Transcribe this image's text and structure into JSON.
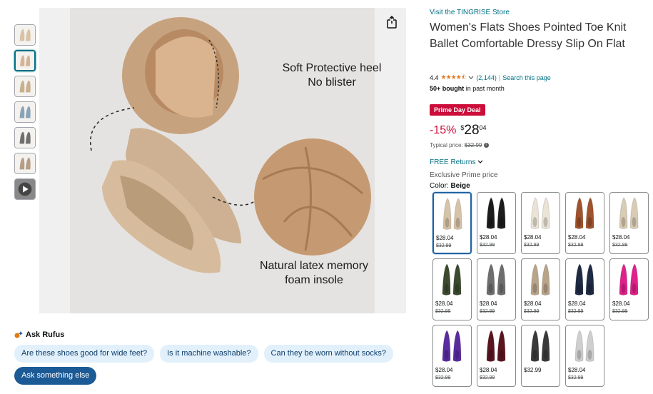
{
  "thumbnails": [
    {
      "name": "thumb-1",
      "color": "#d9c3a6"
    },
    {
      "name": "thumb-2",
      "color": "#d3b596"
    },
    {
      "name": "thumb-3",
      "color": "#c9b08f"
    },
    {
      "name": "thumb-4",
      "color": "#8aa3b8"
    },
    {
      "name": "thumb-5",
      "color": "#6f6f6f"
    },
    {
      "name": "thumb-6",
      "color": "#b49e86"
    },
    {
      "name": "thumb-7",
      "color": "#2f2f2f"
    }
  ],
  "main_image": {
    "caption_top_1": "Soft Protective heel",
    "caption_top_2": "No blister",
    "caption_bottom_1": "Natural latex memory",
    "caption_bottom_2": "foam insole"
  },
  "rufus": {
    "title": "Ask Rufus",
    "chips": [
      "Are these shoes good for wide feet?",
      "Is it machine washable?",
      "Can they be worn without socks?"
    ],
    "ask_label": "Ask something else"
  },
  "product": {
    "store_link": "Visit the TINGRISE Store",
    "title": "Women's Flats Shoes Pointed Toe Knit Ballet Comfortable Dressy Slip On Flat",
    "rating": "4.4",
    "stars": "★★★★⯪",
    "review_count": "(2,144)",
    "separator": "|",
    "search_link": "Search this page",
    "bought_bold": "50+ bought",
    "bought_rest": " in past month",
    "deal_badge": "Prime Day Deal",
    "discount": "-15%",
    "currency": "$",
    "price_whole": "28",
    "price_frac": "04",
    "typical_label": "Typical price: ",
    "typical_price": "$32.99",
    "returns": "FREE Returns",
    "exclusive": "Exclusive Prime price",
    "color_label": "Color: ",
    "color_value": "Beige"
  },
  "swatches": [
    {
      "price": "$28.04",
      "old": "$32.99",
      "color": "#d6c3a8",
      "selected": true
    },
    {
      "price": "$28.04",
      "old": "$32.99",
      "color": "#1c1c1c"
    },
    {
      "price": "$28.04",
      "old": "$32.99",
      "color": "#eae3d6"
    },
    {
      "price": "$28.04",
      "old": "$32.99",
      "color": "#a0522d"
    },
    {
      "price": "$28.04",
      "old": "$32.99",
      "color": "#d9ccb5"
    },
    {
      "price": "$28.04",
      "old": "$32.99",
      "color": "#3c4a2e"
    },
    {
      "price": "$28.04",
      "old": "$32.99",
      "color": "#6e6e6e"
    },
    {
      "price": "$28.04",
      "old": "$32.99",
      "color": "#b9a48a"
    },
    {
      "price": "$28.04",
      "old": "$32.99",
      "color": "#1f2a44"
    },
    {
      "price": "$28.04",
      "old": "$32.99",
      "color": "#e0218a"
    },
    {
      "price": "$28.04",
      "old": "$32.99",
      "color": "#5a2ca0"
    },
    {
      "price": "$28.04",
      "old": "$32.99",
      "color": "#5a1520"
    },
    {
      "price": "$32.99",
      "old": "",
      "color": "#3a3a3a"
    },
    {
      "price": "$28.04",
      "old": "$32.99",
      "color": "#cfcfcf"
    }
  ],
  "colors": {
    "link": "#007185",
    "deal_red": "#cc0c39",
    "star": "#de7921",
    "selected_border": "#2162a1"
  }
}
